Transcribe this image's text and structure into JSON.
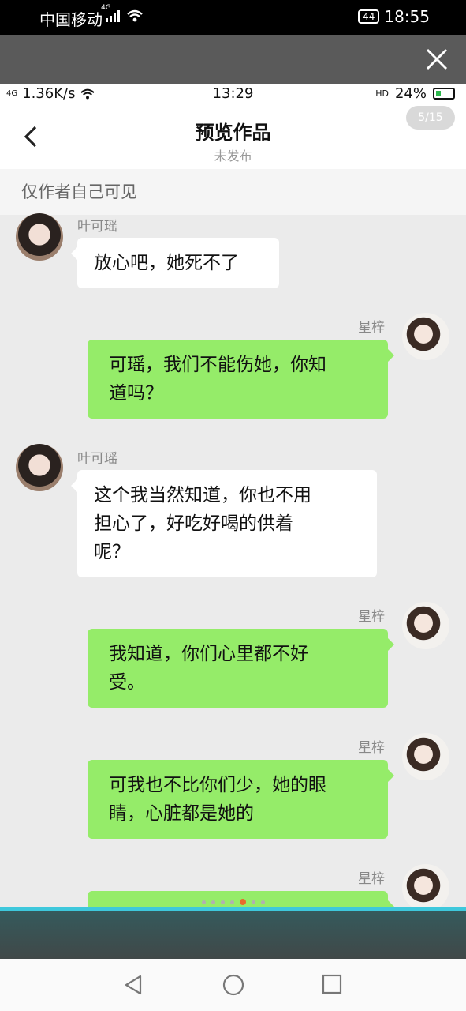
{
  "outer_status": {
    "carrier": "中国移动",
    "network_badge": "4G",
    "battery": "44",
    "time": "18:55"
  },
  "inner_status": {
    "network": "4G",
    "speed": "1.36K/s",
    "time": "13:29",
    "hd": "HD",
    "battery": "24%"
  },
  "header": {
    "title": "预览作品",
    "subtitle": "未发布",
    "page_indicator": "5/15"
  },
  "notice": "仅作者自己可见",
  "messages": [
    {
      "side": "left",
      "sender": "叶可瑶",
      "lines": [
        "放心吧，她死不了"
      ]
    },
    {
      "side": "right",
      "sender": "星梓",
      "lines": [
        "可瑶，我们不能伤她，你知",
        "道吗？"
      ]
    },
    {
      "side": "left",
      "sender": "叶可瑶",
      "lines": [
        "这个我当然知道，你也不用",
        "担心了，好吃好喝的供着",
        "呢？"
      ]
    },
    {
      "side": "right",
      "sender": "星梓",
      "lines": [
        "我知道，你们心里都不好",
        "受。"
      ]
    },
    {
      "side": "right",
      "sender": "星梓",
      "lines": [
        "可我也不比你们少，她的眼",
        "睛，心脏都是她的"
      ]
    },
    {
      "side": "right",
      "sender": "星梓",
      "lines": [
        ""
      ]
    }
  ],
  "pager": {
    "total_dots": 7,
    "active_index": 4
  },
  "icons": {
    "close": "close-icon",
    "back": "chevron-left-icon",
    "nav": [
      "back-triangle-icon",
      "home-circle-icon",
      "recents-square-icon"
    ]
  },
  "colors": {
    "bubble_right": "#95ec69",
    "bubble_left": "#ffffff",
    "chat_bg": "#ebebeb",
    "accent_dot": "#e86a2c",
    "cyan_bar": "#3ec8dc"
  }
}
